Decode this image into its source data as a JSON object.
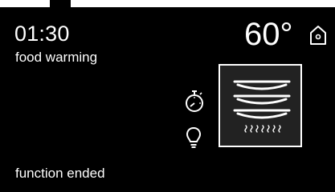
{
  "display": {
    "time": "01:30",
    "program": "food warming",
    "temperature": "60°",
    "status": "function ended"
  },
  "icons": {
    "home": "home-icon",
    "timer": "timer-icon",
    "light": "lightbulb-icon",
    "function": "food-warming-function-icon"
  },
  "colors": {
    "background": "#000000",
    "foreground": "#ffffff",
    "function_box": "#222222"
  }
}
